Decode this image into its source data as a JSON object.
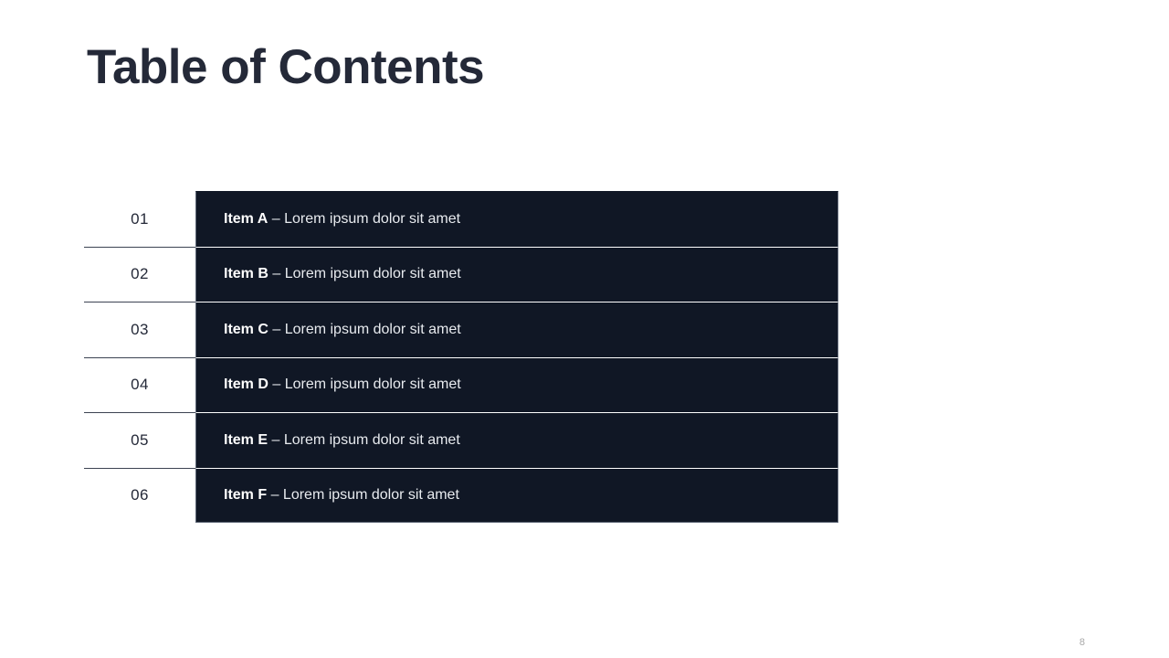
{
  "slide": {
    "title": "Table of Contents",
    "page_number": "8",
    "colors": {
      "bar_background": "#101725",
      "title_text": "#242938",
      "bar_text": "#e8ebef",
      "bar_lead_text": "#ffffff",
      "divider": "#3c4352",
      "page_background": "#ffffff",
      "page_number_text": "#a9a9a9"
    }
  },
  "toc": {
    "rows": [
      {
        "number": "01",
        "lead": "Item A",
        "separator": " – ",
        "description": "Lorem ipsum dolor sit amet"
      },
      {
        "number": "02",
        "lead": "Item B",
        "separator": " – ",
        "description": "Lorem ipsum dolor sit amet"
      },
      {
        "number": "03",
        "lead": "Item C",
        "separator": " – ",
        "description": "Lorem ipsum dolor sit amet"
      },
      {
        "number": "04",
        "lead": "Item D",
        "separator": " – ",
        "description": "Lorem ipsum dolor sit amet"
      },
      {
        "number": "05",
        "lead": "Item E",
        "separator": " – ",
        "description": "Lorem ipsum dolor sit amet"
      },
      {
        "number": "06",
        "lead": "Item F",
        "separator": " – ",
        "description": "Lorem ipsum dolor sit amet"
      }
    ]
  }
}
